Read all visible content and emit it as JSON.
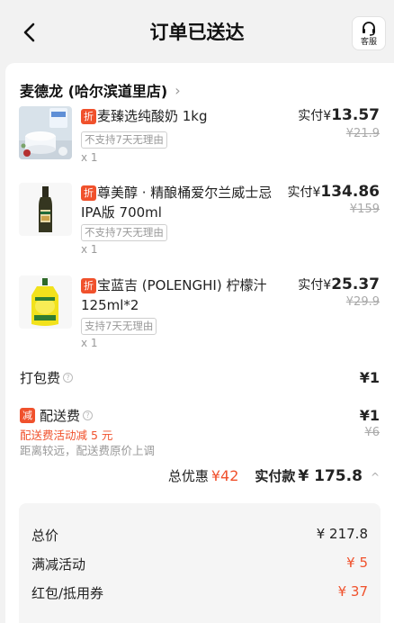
{
  "header": {
    "title": "订单已送达",
    "service_label": "客服"
  },
  "store": {
    "name": "麦德龙 (哈尔滨道里店)"
  },
  "items": [
    {
      "tag": "折",
      "name": "麦臻选纯酸奶 1kg",
      "badge": "不支持7天无理由",
      "qty": "x 1",
      "price_prefix": "实付¥",
      "price": "13.57",
      "original": "¥21.9"
    },
    {
      "tag": "折",
      "name": "尊美醇 · 精酿桶爱尔兰威士忌 IPA版 700ml",
      "badge": "不支持7天无理由",
      "qty": "x 1",
      "price_prefix": "实付¥",
      "price": "134.86",
      "original": "¥159"
    },
    {
      "tag": "折",
      "name": "宝蓝吉 (POLENGHI) 柠檬汁125ml*2",
      "badge": "支持7天无理由",
      "qty": "x 1",
      "price_prefix": "实付¥",
      "price": "25.37",
      "original": "¥29.9"
    }
  ],
  "packing_fee": {
    "label": "打包费",
    "value": "¥1"
  },
  "delivery_fee": {
    "tag": "减",
    "label": "配送费",
    "value": "¥1",
    "original": "¥6",
    "promo": "配送费活动减 5 元",
    "note": "距离较远，配送费原价上调"
  },
  "totals": {
    "discount_label": "总优惠",
    "discount_value": "¥42",
    "paid_label": "实付款",
    "paid_value": "¥ 175.8"
  },
  "breakdown": [
    {
      "label": "总价",
      "value": "¥ 217.8",
      "red": false
    },
    {
      "label": "满减活动",
      "value": "¥ 5",
      "red": true
    },
    {
      "label": "红包/抵用券",
      "value": "¥ 37",
      "red": true
    }
  ],
  "colors": {
    "accent": "#f0512c",
    "background": "#f2f2f2"
  },
  "icons": [
    "back-arrow-icon",
    "headset-icon",
    "chevron-right-icon",
    "question-icon",
    "chevron-up-icon"
  ]
}
